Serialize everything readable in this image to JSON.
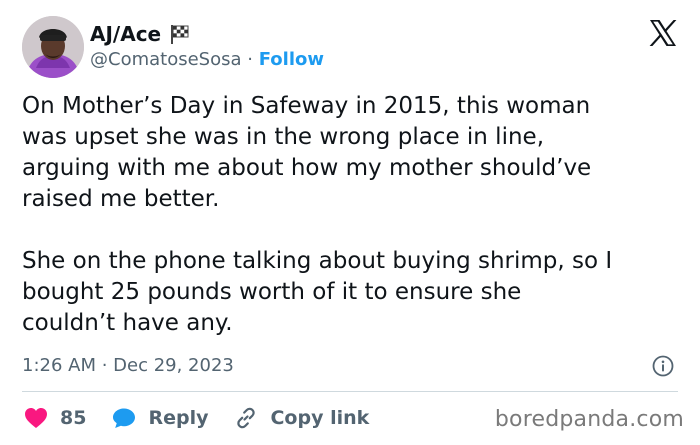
{
  "author": {
    "display_name": "AJ/Ace",
    "handle": "@ComatoseSosa",
    "follow_label": "Follow",
    "separator": "·"
  },
  "tweet": {
    "paragraph_1": "On Mother’s Day in Safeway in 2015, this woman\nwas upset she was in the wrong place in line,\narguing with me about how my mother should’ve\nraised me better.",
    "paragraph_2": "She on the phone talking about buying shrimp, so I\nbought 25 pounds worth of it to ensure she\ncouldn’t have any.",
    "timestamp": "1:26 AM · Dec 29, 2023"
  },
  "actions": {
    "likes": "85",
    "reply_label": "Reply",
    "copy_link_label": "Copy link"
  },
  "watermark": "boredpanda.com",
  "icons": {
    "flag": "checkered-flag-icon",
    "x_logo": "x-logo-icon",
    "info": "info-icon",
    "heart": "heart-icon",
    "reply": "reply-bubble-icon",
    "link": "link-icon"
  },
  "colors": {
    "accent": "#1d9bf0",
    "heart": "#f91880",
    "text": "#0f1419",
    "muted": "#536471",
    "avatar_hoodie": "#9b4fc8"
  }
}
